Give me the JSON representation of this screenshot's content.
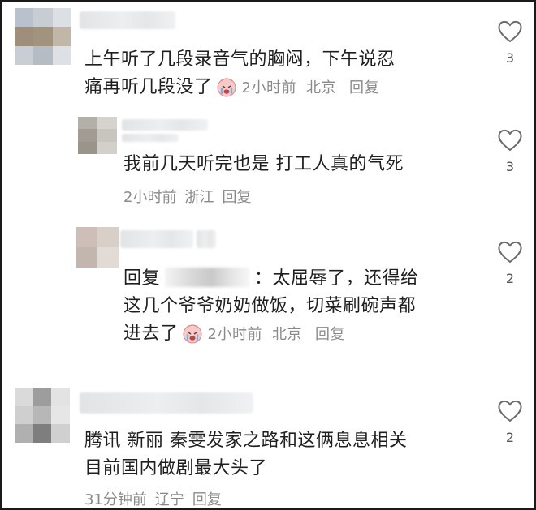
{
  "comments": [
    {
      "text_lines": [
        "上午听了几段录音气的胸闷，下午说忍",
        "痛再听几段没了"
      ],
      "emoji": "crying-face-icon",
      "time": "2小时前",
      "location": "北京",
      "reply_label": "回复",
      "likes": "3"
    },
    {
      "text_lines": [
        "我前几天听完也是 打工人真的气死"
      ],
      "time": "2小时前",
      "location": "浙江",
      "reply_label": "回复",
      "likes": "3"
    },
    {
      "reply_prefix": "回复",
      "colon": "：",
      "text_lines": [
        "太屈辱了，还得给",
        "这几个爷爷奶奶做饭，切菜刷碗声都",
        "进去了"
      ],
      "emoji": "crying-face-icon",
      "time": "2小时前",
      "location": "北京",
      "reply_label": "回复",
      "likes": "2"
    },
    {
      "text_lines": [
        "腾讯 新丽 秦雯发家之路和这俩息息相关",
        "目前国内做剧最大头了"
      ],
      "time": "31分钟前",
      "location": "辽宁",
      "reply_label": "回复",
      "likes": "2"
    }
  ],
  "colors": {
    "meta_gray": "#8a8a8a",
    "text": "#1f1f1f",
    "heart_stroke": "#6b6b6b"
  }
}
